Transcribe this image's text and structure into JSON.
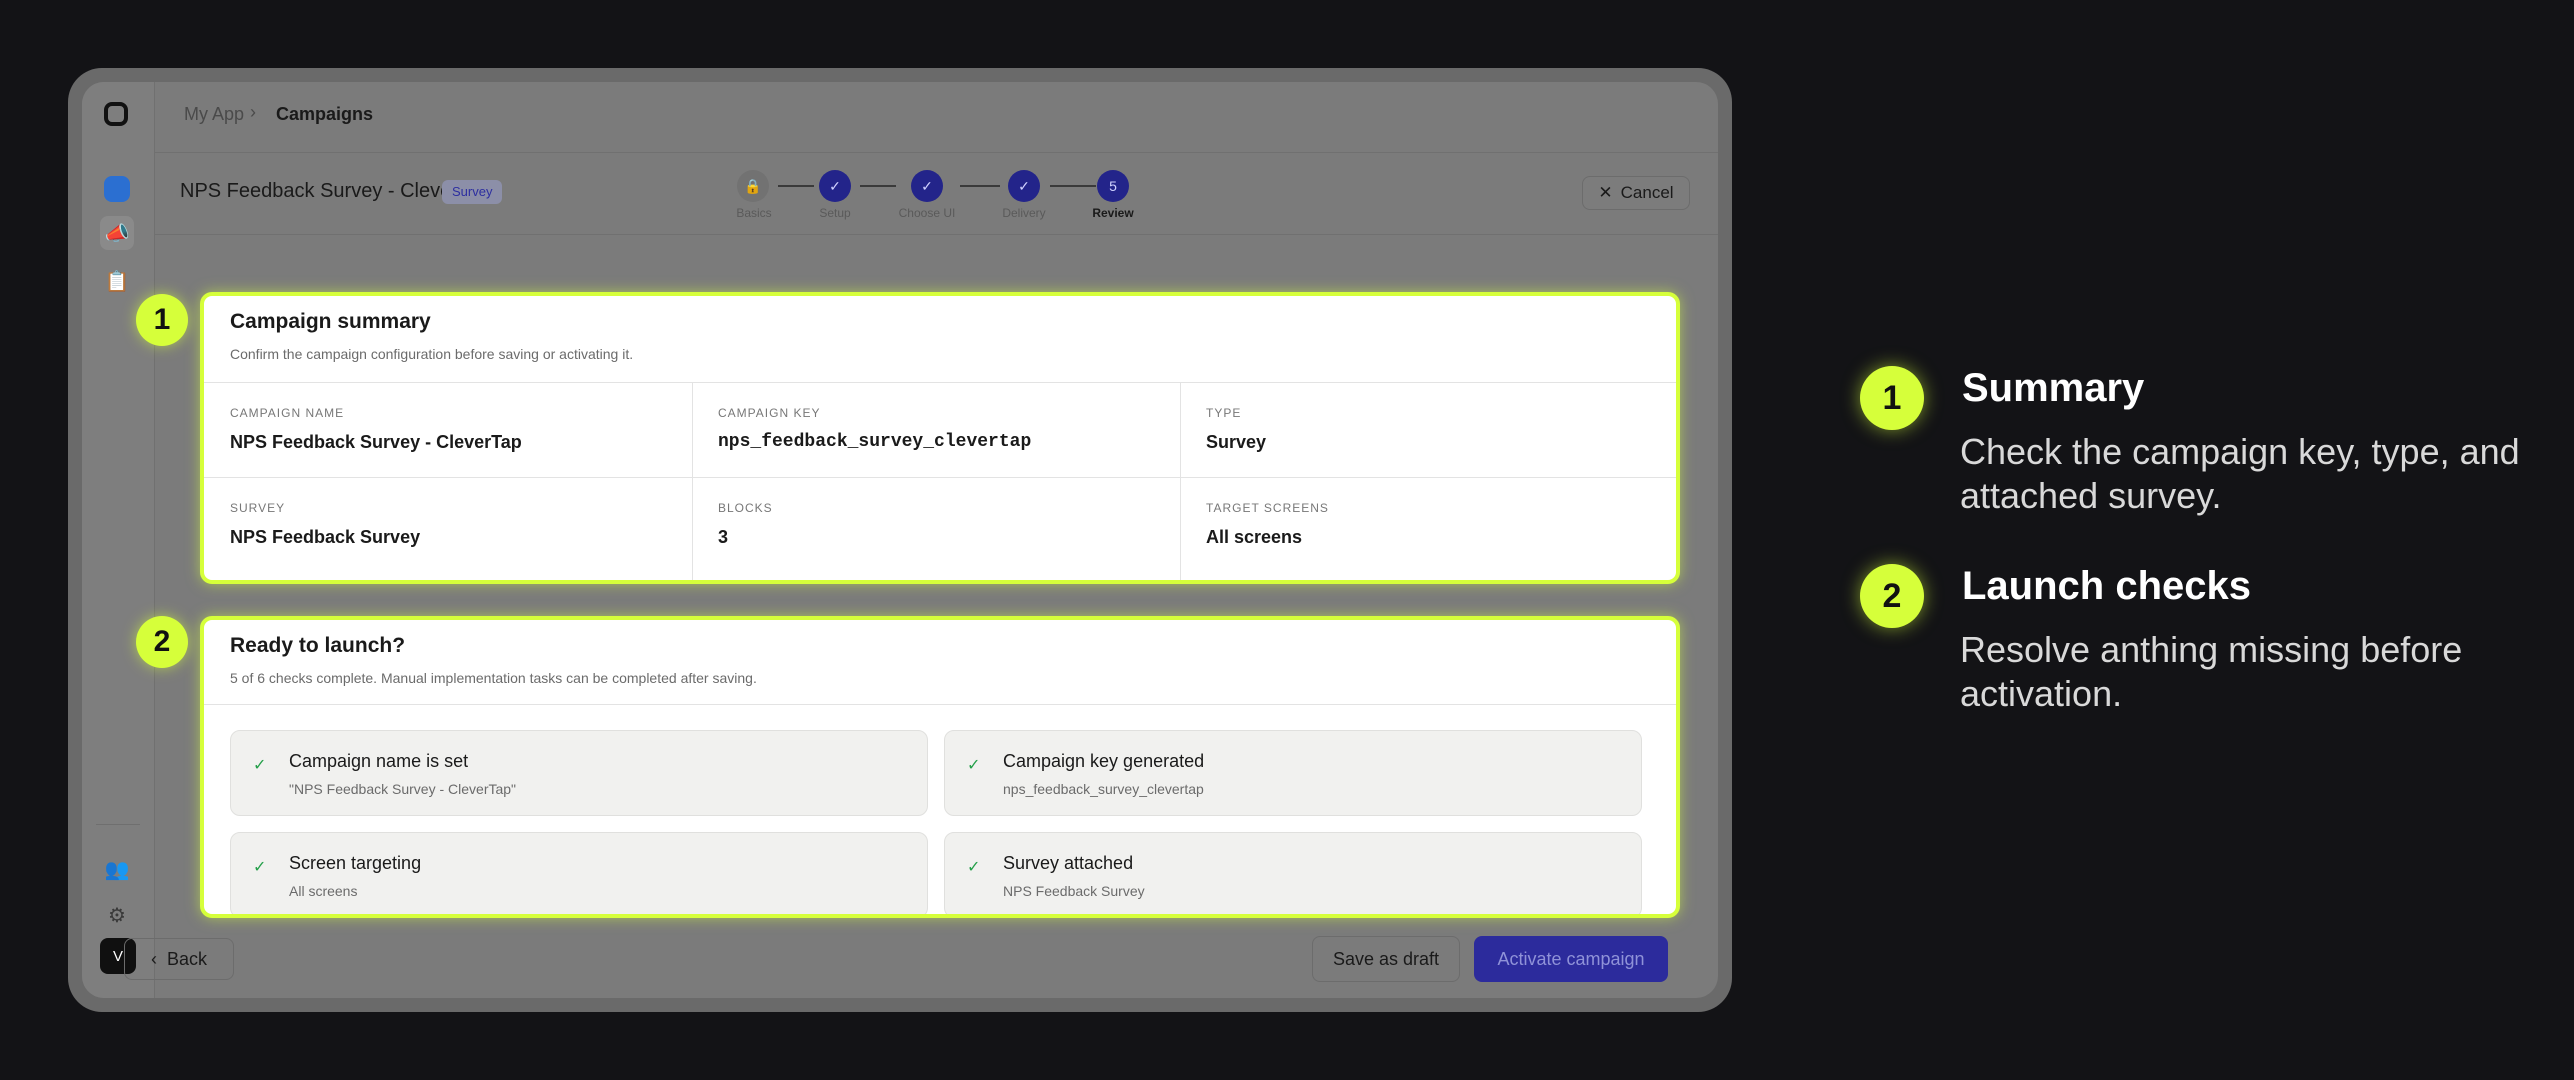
{
  "breadcrumb": {
    "app": "My App",
    "current": "Campaigns"
  },
  "header": {
    "title": "NPS Feedback Survey - Cleve...",
    "badge": "Survey",
    "cancel": "Cancel"
  },
  "steps": [
    {
      "label": "Basics",
      "state": "lock"
    },
    {
      "label": "Setup",
      "state": "done"
    },
    {
      "label": "Choose UI",
      "state": "done"
    },
    {
      "label": "Delivery",
      "state": "done"
    },
    {
      "label": "Review",
      "state": "current",
      "number": "5"
    }
  ],
  "summary": {
    "title": "Campaign summary",
    "subtitle": "Confirm the campaign configuration before saving or activating it.",
    "fields": [
      {
        "key": "CAMPAIGN NAME",
        "value": "NPS Feedback Survey - CleverTap"
      },
      {
        "key": "CAMPAIGN KEY",
        "value": "nps_feedback_survey_clevertap"
      },
      {
        "key": "TYPE",
        "value": "Survey"
      },
      {
        "key": "SURVEY",
        "value": "NPS Feedback Survey"
      },
      {
        "key": "BLOCKS",
        "value": "3"
      },
      {
        "key": "TARGET SCREENS",
        "value": "All screens"
      }
    ]
  },
  "launch": {
    "title": "Ready to launch?",
    "subtitle": "5 of 6 checks complete. Manual implementation tasks can be completed after saving.",
    "checks": [
      {
        "title": "Campaign name is set",
        "detail": "\"NPS Feedback Survey - CleverTap\""
      },
      {
        "title": "Campaign key generated",
        "detail": "nps_feedback_survey_clevertap"
      },
      {
        "title": "Screen targeting",
        "detail": "All screens"
      },
      {
        "title": "Survey attached",
        "detail": "NPS Feedback Survey"
      }
    ]
  },
  "footer": {
    "back": "Back",
    "draft": "Save as draft",
    "activate": "Activate campaign"
  },
  "avatar": "V",
  "callouts": [
    {
      "number": "1",
      "title": "Summary",
      "description": "Check the campaign key, type, and attached survey."
    },
    {
      "number": "2",
      "title": "Launch checks",
      "description": "Resolve anthing missing before activation."
    }
  ],
  "colors": {
    "highlight": "#d6ff3a",
    "primary": "#2c2b9c",
    "background": "#131316"
  }
}
